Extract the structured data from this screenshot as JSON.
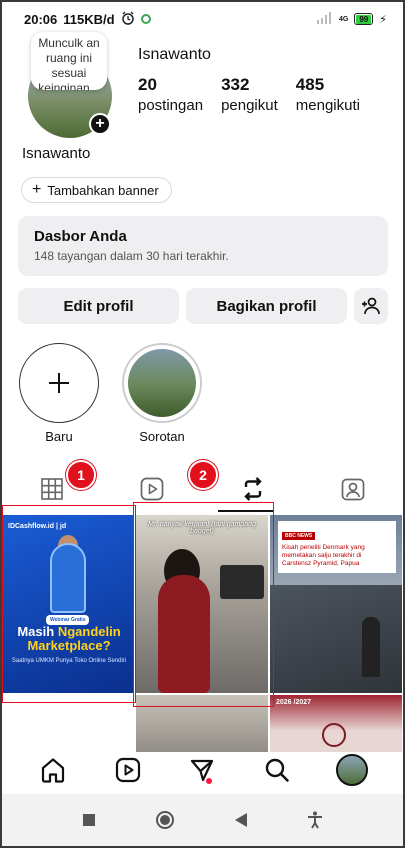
{
  "status_bar": {
    "time": "20:06",
    "speed": "115KB/d",
    "network_label": "4G",
    "battery": "99"
  },
  "profile": {
    "note": "Munculk an ruang ini sesuai keinginan...",
    "username": "Isnawanto",
    "name": "Isnawanto",
    "stats": [
      {
        "value": "20",
        "label": "postingan"
      },
      {
        "value": "332",
        "label": "pengikut"
      },
      {
        "value": "485",
        "label": "mengikuti"
      }
    ],
    "banner_button": "Tambahkan banner"
  },
  "dashboard": {
    "title": "Dasbor Anda",
    "subtitle": "148 tayangan dalam 30 hari terakhir."
  },
  "actions": {
    "edit": "Edit profil",
    "share": "Bagikan profil"
  },
  "highlights": [
    {
      "label": "Baru"
    },
    {
      "label": "Sorotan"
    }
  ],
  "annotations": {
    "marker1": "1",
    "marker2": "2"
  },
  "posts": {
    "p1": {
      "brand": "IDCashflow.id  |  jd",
      "ribbon": "Webinar Gratis",
      "headline_a": "Masih ",
      "headline_b": "Ngandelin",
      "headline_c": "Marketplace?",
      "sub": "Saatnya UMKM Punya Toko Online Sendiri"
    },
    "p2": {
      "caption": "Mr. hanyak kerjaan! (tapi gampang banget)"
    },
    "p3": {
      "tag": "BBC NEWS",
      "text": "Kisah peneliti Denmark yang memetakan salju terakhir di Carstensz Pyramid, Papua"
    },
    "p5": {
      "year": "2026 /2027"
    }
  },
  "colors": {
    "accent_red": "#e0101d",
    "surface": "#efeff1"
  }
}
